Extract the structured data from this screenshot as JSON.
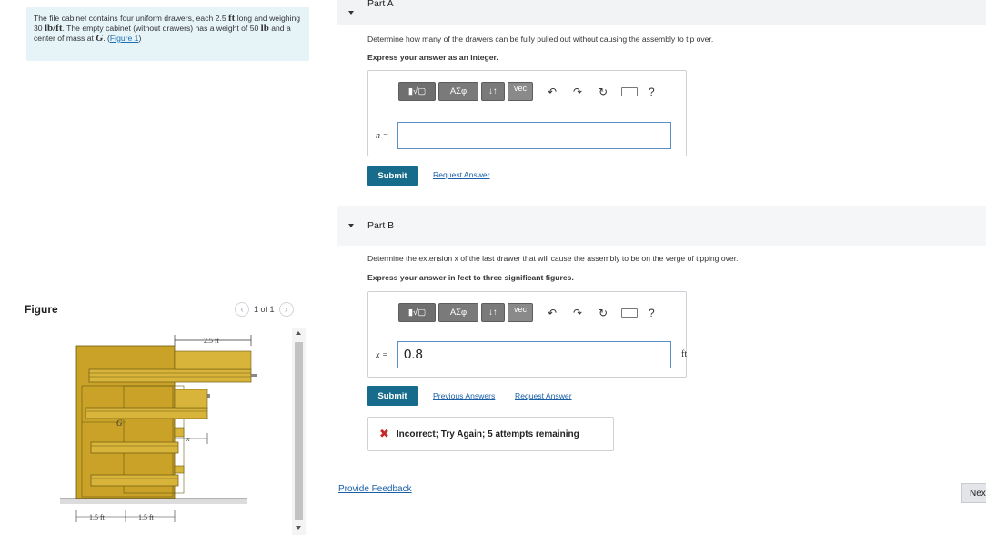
{
  "problem": {
    "text_1": "The file cabinet contains four uniform drawers, each 2.5 ",
    "unit_ft": "ft",
    "text_2": " long and weighing 30 ",
    "unit_lbft": "lb/ft",
    "text_3": ". The empty cabinet (without drawers) has a weight of 50 ",
    "unit_lb": "lb",
    "text_4": " and a center of mass at ",
    "var_g": "G",
    "text_5": ". (",
    "figure_link": "Figure 1",
    "text_6": ")"
  },
  "figure": {
    "title": "Figure",
    "pager": "1 of 1",
    "prev_icon": "chevron-left-icon",
    "next_icon": "chevron-right-icon",
    "label_top": "2.5 ft",
    "label_g": "G",
    "label_x": "x",
    "label_bottom_left": "1.5 ft",
    "label_bottom_right": "1.5 ft",
    "colors": {
      "cabinet": "#c9a227",
      "drawer": "#d9b43a",
      "dark": "#6b5a12"
    }
  },
  "part_a": {
    "header": "Part A",
    "prompt": "Determine how many of the drawers can be fully pulled out without causing the assembly to tip over.",
    "format": "Express your answer as an integer.",
    "var": "n =",
    "value": "",
    "submit": "Submit",
    "request": "Request Answer"
  },
  "part_b": {
    "header": "Part B",
    "prompt": "Determine the extension x of the last drawer that will cause the assembly to be on the verge of tipping over.",
    "format": "Express your answer in feet to three significant figures.",
    "var": "x =",
    "value": "0.8",
    "unit": "ft",
    "submit": "Submit",
    "previous": "Previous Answers",
    "request": "Request Answer",
    "feedback": "Incorrect; Try Again; 5 attempts remaining"
  },
  "toolbar": {
    "templates": "▮√▢",
    "greek": "ΑΣφ",
    "arrows": "↓↑",
    "vec": "vec",
    "undo_icon": "undo-icon",
    "redo_icon": "redo-icon",
    "reset_icon": "reset-icon",
    "keyboard_icon": "keyboard-icon",
    "help": "?"
  },
  "footer": {
    "provide_feedback": "Provide Feedback",
    "next": "Next"
  }
}
